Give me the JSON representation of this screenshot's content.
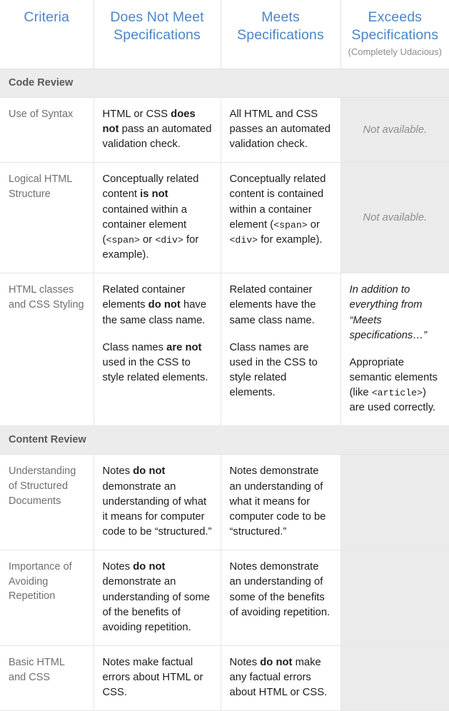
{
  "header": {
    "criteria": "Criteria",
    "does_not_meet": "Does Not Meet Specifications",
    "meets": "Meets Specifications",
    "exceeds": "Exceeds Specifications",
    "exceeds_sub": "(Completely Udacious)"
  },
  "colors": {
    "header_blue": "#4a86c8",
    "section_band": "#ececec",
    "section_text": "#585858",
    "criteria_text": "#6f6f6f",
    "body_text": "#1c1c1c",
    "na_background": "#ebebeb",
    "na_text": "#8d8d8d",
    "border": "#e6e6e6"
  },
  "sections": [
    {
      "title": "Code Review",
      "rows": [
        {
          "criteria": "Use of Syntax",
          "does_not_meet": [
            {
              "parts": [
                {
                  "t": "HTML or CSS "
                },
                {
                  "t": "does not",
                  "bold": true
                },
                {
                  "t": " pass an automated validation check."
                }
              ]
            }
          ],
          "meets": [
            {
              "parts": [
                {
                  "t": "All HTML and CSS passes an automated validation check."
                }
              ]
            }
          ],
          "exceeds_kind": "na",
          "exceeds_text": "Not available."
        },
        {
          "criteria": "Logical HTML Structure",
          "does_not_meet": [
            {
              "parts": [
                {
                  "t": "Conceptually related content "
                },
                {
                  "t": "is not",
                  "bold": true
                },
                {
                  "t": " contained within a container element ("
                },
                {
                  "t": "<span>",
                  "mono": true
                },
                {
                  "t": " or "
                },
                {
                  "t": "<div>",
                  "mono": true
                },
                {
                  "t": " for example)."
                }
              ]
            }
          ],
          "meets": [
            {
              "parts": [
                {
                  "t": "Conceptually related content is contained within a container element ("
                },
                {
                  "t": "<span>",
                  "mono": true
                },
                {
                  "t": " or "
                },
                {
                  "t": "<div>",
                  "mono": true
                },
                {
                  "t": " for example)."
                }
              ]
            }
          ],
          "exceeds_kind": "na",
          "exceeds_text": "Not available."
        },
        {
          "criteria": "HTML classes and CSS Styling",
          "does_not_meet": [
            {
              "parts": [
                {
                  "t": "Related container elements "
                },
                {
                  "t": "do not",
                  "bold": true
                },
                {
                  "t": " have the same class name."
                }
              ]
            },
            {
              "parts": [
                {
                  "t": "Class names "
                },
                {
                  "t": "are not",
                  "bold": true
                },
                {
                  "t": " used in the CSS to style related elements."
                }
              ]
            }
          ],
          "meets": [
            {
              "parts": [
                {
                  "t": "Related container elements have the same class name."
                }
              ]
            },
            {
              "parts": [
                {
                  "t": "Class names are used in the CSS to style related elements."
                }
              ]
            }
          ],
          "exceeds_kind": "content",
          "exceeds": [
            {
              "parts": [
                {
                  "t": "In addition to everything from “Meets specifications…”",
                  "italic": true
                }
              ]
            },
            {
              "parts": [
                {
                  "t": "Appropriate semantic elements (like "
                },
                {
                  "t": "<article>",
                  "mono": true
                },
                {
                  "t": ") are used correctly."
                }
              ]
            }
          ]
        }
      ]
    },
    {
      "title": "Content Review",
      "rows": [
        {
          "criteria": "Understanding of Structured Documents",
          "does_not_meet": [
            {
              "parts": [
                {
                  "t": "Notes "
                },
                {
                  "t": "do not",
                  "bold": true
                },
                {
                  "t": " demonstrate an understanding of what it means for computer code to be “structured.”"
                }
              ]
            }
          ],
          "meets": [
            {
              "parts": [
                {
                  "t": "Notes demonstrate an understanding of what it means for computer code to be “structured.”"
                }
              ]
            }
          ],
          "exceeds_kind": "empty",
          "exceeds_text": ""
        },
        {
          "criteria": "Importance of Avoiding Repetition",
          "does_not_meet": [
            {
              "parts": [
                {
                  "t": "Notes "
                },
                {
                  "t": "do not",
                  "bold": true
                },
                {
                  "t": " demonstrate an understanding of some of the benefits of avoiding repetition."
                }
              ]
            }
          ],
          "meets": [
            {
              "parts": [
                {
                  "t": "Notes demonstrate an understanding of some of the benefits of avoiding repetition."
                }
              ]
            }
          ],
          "exceeds_kind": "empty",
          "exceeds_text": ""
        },
        {
          "criteria": "Basic HTML and CSS",
          "does_not_meet": [
            {
              "parts": [
                {
                  "t": "Notes make factual errors about HTML or CSS."
                }
              ]
            }
          ],
          "meets": [
            {
              "parts": [
                {
                  "t": "Notes "
                },
                {
                  "t": "do not",
                  "bold": true
                },
                {
                  "t": " make any factual errors about HTML or CSS."
                }
              ]
            }
          ],
          "exceeds_kind": "empty",
          "exceeds_text": ""
        }
      ]
    }
  ]
}
